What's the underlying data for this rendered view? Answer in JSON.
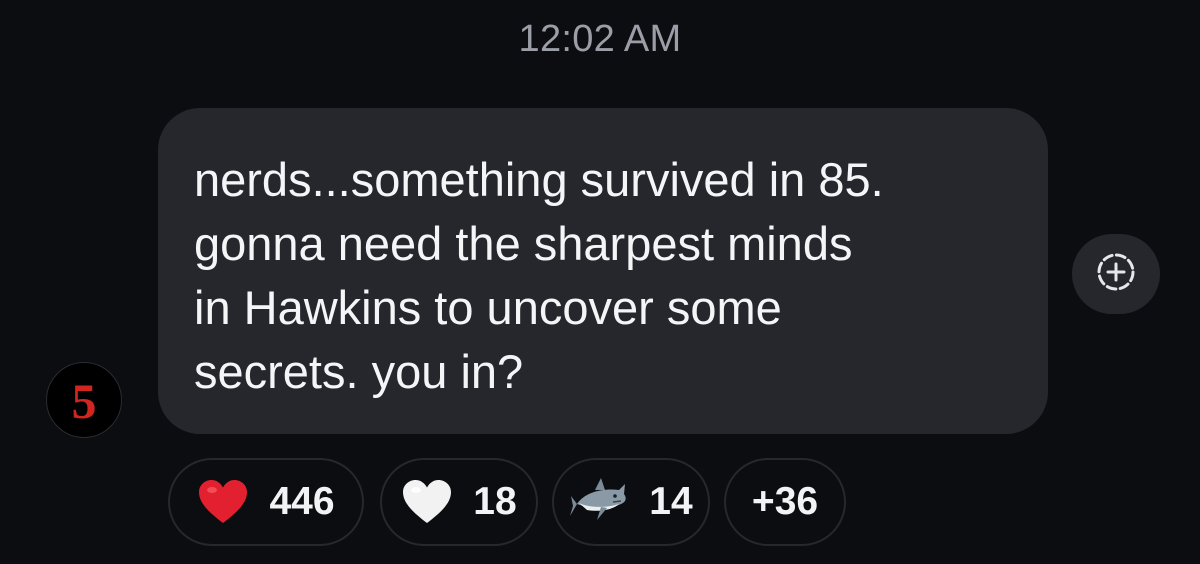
{
  "timestamp": "12:02 AM",
  "sender": {
    "avatar_glyph": "5",
    "avatar_color": "#d0261f"
  },
  "message": {
    "lines": [
      "nerds...something survived in 85.",
      "gonna need the sharpest minds",
      "in Hawkins to uncover some",
      "secrets. you in?"
    ]
  },
  "add_reaction": {
    "icon": "add-reaction-icon"
  },
  "reactions": [
    {
      "emoji": "red-heart-icon",
      "count": "446"
    },
    {
      "emoji": "white-heart-icon",
      "count": "18"
    },
    {
      "emoji": "shark-icon",
      "count": "14"
    },
    {
      "emoji": "",
      "count": "+36"
    }
  ],
  "colors": {
    "background": "#0b0d11",
    "bubble": "#25272d",
    "timestamp_text": "#9b9ea6",
    "heart_red": "#e3202f"
  }
}
